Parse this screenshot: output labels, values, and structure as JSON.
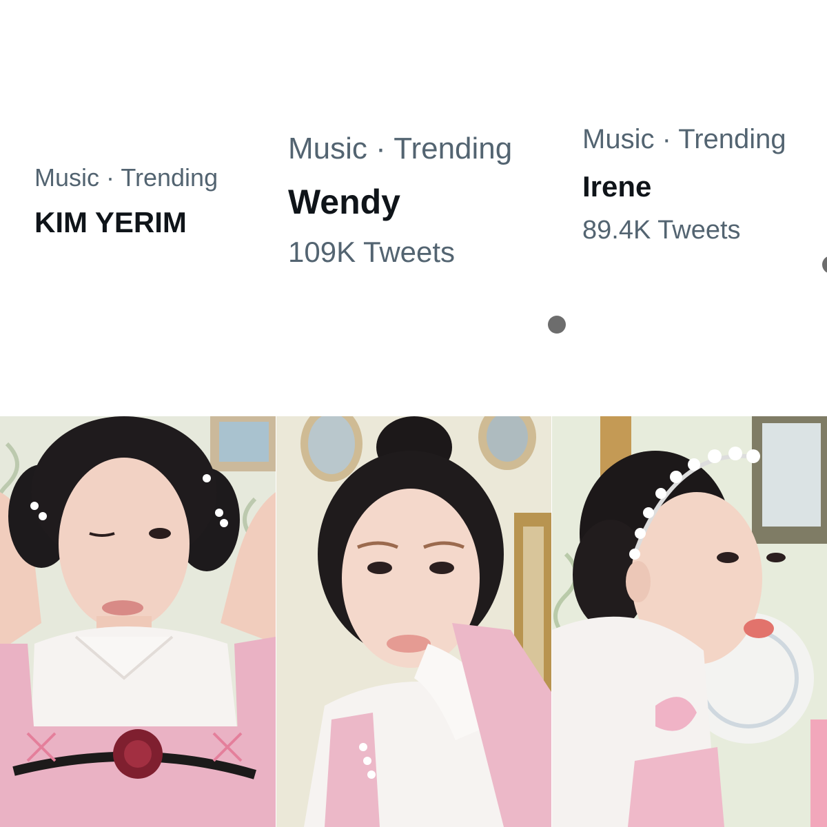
{
  "trends": [
    {
      "category": "Music · Trending",
      "name": "KIM YERIM",
      "count": ""
    },
    {
      "category": "Music · Trending",
      "name": "Wendy",
      "count": "109K Tweets"
    },
    {
      "category": "Music · Trending",
      "name": "Irene",
      "count": "89.4K Tweets"
    }
  ],
  "colors": {
    "secondary_text": "#536471",
    "primary_text": "#0f1419",
    "background": "#ffffff",
    "blouse": "#f6f3f1",
    "tweed_pink": "#eab2c4",
    "wallpaper": "#e8ecdc"
  },
  "icons": [
    "more-options-icon",
    "more-options-icon"
  ]
}
